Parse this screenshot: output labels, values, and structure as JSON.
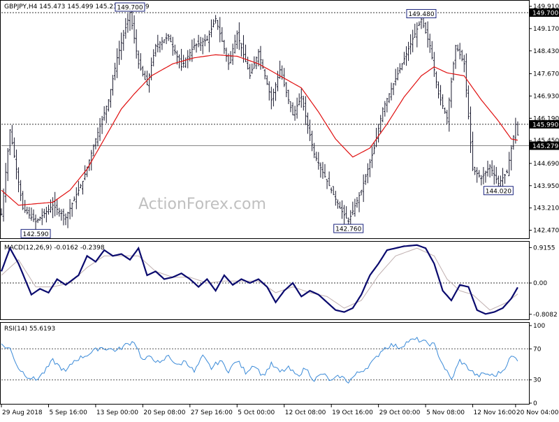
{
  "chart_data": [
    {
      "type": "candlestick",
      "panel": "price",
      "header": "GBPJPY,H4  145.473 145.499 145.230 145.279",
      "watermark": "ActionForex.com",
      "ylim": [
        142.25,
        150.05
      ],
      "yticks": [
        "149.910",
        "149.170",
        "148.430",
        "147.670",
        "146.930",
        "146.190",
        "145.450",
        "144.690",
        "143.950",
        "143.210",
        "142.470"
      ],
      "ytick_values": [
        149.91,
        149.17,
        148.43,
        147.67,
        146.93,
        146.19,
        145.45,
        144.69,
        143.95,
        143.21,
        142.47
      ],
      "price_path": [
        [
          0,
          143.0
        ],
        [
          4,
          145.8
        ],
        [
          10,
          143.2
        ],
        [
          16,
          142.75
        ],
        [
          24,
          143.3
        ],
        [
          30,
          142.9
        ],
        [
          38,
          144.1
        ],
        [
          44,
          145.5
        ],
        [
          50,
          146.8
        ],
        [
          54,
          148.2
        ],
        [
          58,
          149.2
        ],
        [
          60,
          149.7
        ],
        [
          64,
          148.0
        ],
        [
          68,
          147.3
        ],
        [
          72,
          148.6
        ],
        [
          78,
          148.9
        ],
        [
          84,
          147.9
        ],
        [
          90,
          148.6
        ],
        [
          96,
          148.8
        ],
        [
          100,
          149.5
        ],
        [
          106,
          148.0
        ],
        [
          110,
          149.0
        ],
        [
          116,
          147.6
        ],
        [
          120,
          148.4
        ],
        [
          126,
          146.8
        ],
        [
          130,
          147.8
        ],
        [
          136,
          146.3
        ],
        [
          140,
          146.9
        ],
        [
          146,
          145.0
        ],
        [
          152,
          144.1
        ],
        [
          158,
          143.2
        ],
        [
          162,
          142.76
        ],
        [
          168,
          143.8
        ],
        [
          174,
          145.2
        ],
        [
          178,
          146.5
        ],
        [
          184,
          147.5
        ],
        [
          190,
          148.5
        ],
        [
          196,
          149.48
        ],
        [
          200,
          148.6
        ],
        [
          204,
          147.0
        ],
        [
          208,
          146.2
        ],
        [
          212,
          148.6
        ],
        [
          216,
          148.0
        ],
        [
          220,
          144.5
        ],
        [
          224,
          144.2
        ],
        [
          228,
          144.6
        ],
        [
          232,
          144.02
        ],
        [
          236,
          144.4
        ],
        [
          240,
          145.99
        ],
        [
          242,
          145.279
        ]
      ],
      "ma_path": [
        [
          0,
          143.8
        ],
        [
          8,
          143.3
        ],
        [
          16,
          143.35
        ],
        [
          24,
          143.4
        ],
        [
          32,
          143.8
        ],
        [
          40,
          144.5
        ],
        [
          48,
          145.5
        ],
        [
          56,
          146.5
        ],
        [
          62,
          147.0
        ],
        [
          70,
          147.6
        ],
        [
          80,
          148.0
        ],
        [
          90,
          148.2
        ],
        [
          100,
          148.3
        ],
        [
          110,
          148.25
        ],
        [
          120,
          148.0
        ],
        [
          130,
          147.6
        ],
        [
          140,
          147.2
        ],
        [
          148,
          146.4
        ],
        [
          156,
          145.5
        ],
        [
          164,
          144.9
        ],
        [
          172,
          145.2
        ],
        [
          180,
          146.0
        ],
        [
          188,
          146.9
        ],
        [
          196,
          147.6
        ],
        [
          202,
          147.9
        ],
        [
          208,
          147.7
        ],
        [
          216,
          147.6
        ],
        [
          224,
          146.8
        ],
        [
          232,
          146.1
        ],
        [
          238,
          145.5
        ],
        [
          242,
          145.45
        ]
      ],
      "n_bars": 242,
      "ma_color": "#e01010",
      "bar_color": "#1a1a2e",
      "horizontal_lines": [
        149.7,
        145.99
      ],
      "labeled_levels": [
        {
          "label": "149.700",
          "value": 149.7,
          "bar": 60,
          "pos": "above"
        },
        {
          "label": "142.590",
          "value": 142.59,
          "bar": 16,
          "pos": "below"
        },
        {
          "label": "142.760",
          "value": 142.76,
          "bar": 162,
          "pos": "below"
        },
        {
          "label": "149.480",
          "value": 149.48,
          "bar": 196,
          "pos": "above"
        },
        {
          "label": "144.020",
          "value": 144.02,
          "bar": 232,
          "pos": "below"
        }
      ],
      "axis_tags": [
        {
          "label": "149.700",
          "value": 149.7
        },
        {
          "label": "145.990",
          "value": 145.99
        },
        {
          "label": "145.279",
          "value": 145.279
        }
      ]
    },
    {
      "type": "line",
      "panel": "macd",
      "header": "MACD(12,26,9) -0.0162 -0.2398",
      "ylim": [
        -0.92,
        1.03
      ],
      "yticks": [
        "0.9155",
        "0.00",
        "-0.8082"
      ],
      "ytick_values": [
        0.9155,
        0.0,
        -0.8082
      ],
      "macd_path": [
        [
          0,
          0.3
        ],
        [
          4,
          0.9
        ],
        [
          8,
          0.5
        ],
        [
          14,
          -0.3
        ],
        [
          18,
          -0.15
        ],
        [
          22,
          -0.25
        ],
        [
          26,
          0.1
        ],
        [
          30,
          -0.05
        ],
        [
          36,
          0.2
        ],
        [
          40,
          0.7
        ],
        [
          44,
          0.55
        ],
        [
          48,
          0.85
        ],
        [
          52,
          0.7
        ],
        [
          56,
          0.75
        ],
        [
          60,
          0.6
        ],
        [
          64,
          0.9
        ],
        [
          68,
          0.2
        ],
        [
          72,
          0.3
        ],
        [
          76,
          0.1
        ],
        [
          80,
          0.15
        ],
        [
          84,
          0.25
        ],
        [
          88,
          0.1
        ],
        [
          92,
          -0.1
        ],
        [
          96,
          0.1
        ],
        [
          100,
          -0.2
        ],
        [
          104,
          0.2
        ],
        [
          108,
          -0.05
        ],
        [
          112,
          0.1
        ],
        [
          116,
          0.0
        ],
        [
          120,
          0.1
        ],
        [
          124,
          -0.1
        ],
        [
          128,
          -0.5
        ],
        [
          132,
          -0.2
        ],
        [
          136,
          0.0
        ],
        [
          140,
          -0.35
        ],
        [
          144,
          -0.2
        ],
        [
          148,
          -0.3
        ],
        [
          152,
          -0.5
        ],
        [
          156,
          -0.7
        ],
        [
          160,
          -0.75
        ],
        [
          164,
          -0.65
        ],
        [
          168,
          -0.3
        ],
        [
          172,
          0.2
        ],
        [
          176,
          0.5
        ],
        [
          180,
          0.85
        ],
        [
          188,
          0.95
        ],
        [
          194,
          0.98
        ],
        [
          198,
          0.9
        ],
        [
          202,
          0.5
        ],
        [
          206,
          -0.2
        ],
        [
          210,
          -0.45
        ],
        [
          214,
          -0.05
        ],
        [
          218,
          -0.1
        ],
        [
          222,
          -0.7
        ],
        [
          226,
          -0.8
        ],
        [
          230,
          -0.75
        ],
        [
          234,
          -0.65
        ],
        [
          238,
          -0.4
        ],
        [
          242,
          -0.0162
        ]
      ],
      "signal_path": [
        [
          0,
          0.2
        ],
        [
          8,
          0.6
        ],
        [
          16,
          -0.1
        ],
        [
          24,
          -0.1
        ],
        [
          32,
          0.0
        ],
        [
          40,
          0.4
        ],
        [
          48,
          0.7
        ],
        [
          56,
          0.7
        ],
        [
          64,
          0.7
        ],
        [
          72,
          0.3
        ],
        [
          80,
          0.15
        ],
        [
          88,
          0.15
        ],
        [
          96,
          0.0
        ],
        [
          104,
          0.05
        ],
        [
          112,
          0.05
        ],
        [
          120,
          0.05
        ],
        [
          128,
          -0.25
        ],
        [
          136,
          -0.1
        ],
        [
          144,
          -0.25
        ],
        [
          152,
          -0.35
        ],
        [
          160,
          -0.65
        ],
        [
          168,
          -0.45
        ],
        [
          176,
          0.2
        ],
        [
          184,
          0.7
        ],
        [
          194,
          0.9
        ],
        [
          202,
          0.7
        ],
        [
          208,
          0.1
        ],
        [
          214,
          -0.2
        ],
        [
          220,
          -0.3
        ],
        [
          228,
          -0.7
        ],
        [
          236,
          -0.5
        ],
        [
          242,
          -0.2398
        ]
      ],
      "zero_line": 0.0,
      "macd_color": "#0a0a6e",
      "signal_color": "#c0b0b0"
    },
    {
      "type": "line",
      "panel": "rsi",
      "header": "RSI(14) 55.6193",
      "ylim": [
        0,
        100
      ],
      "yticks": [
        "100",
        "70",
        "30",
        "0"
      ],
      "ytick_values": [
        100,
        70,
        30,
        0
      ],
      "rsi_path": [
        [
          0,
          75
        ],
        [
          4,
          70
        ],
        [
          8,
          45
        ],
        [
          12,
          35
        ],
        [
          16,
          30
        ],
        [
          20,
          40
        ],
        [
          24,
          55
        ],
        [
          26,
          50
        ],
        [
          30,
          40
        ],
        [
          34,
          55
        ],
        [
          38,
          60
        ],
        [
          42,
          65
        ],
        [
          46,
          72
        ],
        [
          50,
          70
        ],
        [
          54,
          68
        ],
        [
          58,
          75
        ],
        [
          62,
          80
        ],
        [
          66,
          55
        ],
        [
          70,
          60
        ],
        [
          74,
          50
        ],
        [
          78,
          62
        ],
        [
          82,
          48
        ],
        [
          86,
          55
        ],
        [
          90,
          40
        ],
        [
          94,
          60
        ],
        [
          98,
          45
        ],
        [
          102,
          55
        ],
        [
          106,
          42
        ],
        [
          110,
          55
        ],
        [
          114,
          40
        ],
        [
          118,
          50
        ],
        [
          122,
          35
        ],
        [
          126,
          50
        ],
        [
          130,
          40
        ],
        [
          134,
          45
        ],
        [
          138,
          35
        ],
        [
          142,
          45
        ],
        [
          146,
          30
        ],
        [
          150,
          38
        ],
        [
          154,
          28
        ],
        [
          158,
          35
        ],
        [
          162,
          28
        ],
        [
          166,
          38
        ],
        [
          170,
          45
        ],
        [
          174,
          55
        ],
        [
          178,
          70
        ],
        [
          182,
          75
        ],
        [
          186,
          72
        ],
        [
          190,
          80
        ],
        [
          194,
          82
        ],
        [
          198,
          78
        ],
        [
          202,
          75
        ],
        [
          206,
          50
        ],
        [
          210,
          30
        ],
        [
          214,
          55
        ],
        [
          218,
          45
        ],
        [
          222,
          35
        ],
        [
          226,
          38
        ],
        [
          230,
          35
        ],
        [
          234,
          42
        ],
        [
          238,
          60
        ],
        [
          242,
          55.6193
        ]
      ],
      "guide_lines": [
        70,
        30
      ],
      "rsi_color": "#3a8ad8"
    }
  ],
  "x_axis": {
    "tick_labels": [
      "29 Aug 2018",
      "5 Sep 16:00",
      "13 Sep 00:00",
      "20 Sep 08:00",
      "27 Sep 16:00",
      "5 Oct 00:00",
      "12 Oct 08:00",
      "19 Oct 16:00",
      "29 Oct 00:00",
      "5 Nov 08:00",
      "12 Nov 16:00",
      "20 Nov 04:00"
    ],
    "tick_bars": [
      0,
      22,
      44,
      66,
      88,
      110,
      132,
      154,
      176,
      198,
      220,
      240
    ]
  }
}
